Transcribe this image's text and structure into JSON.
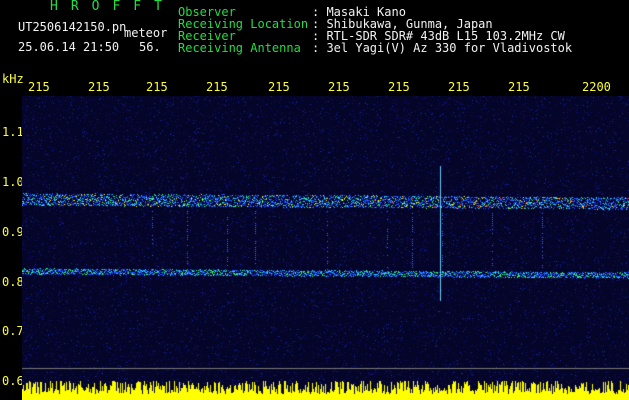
{
  "header": {
    "logo": "HROFFT",
    "filename": "UT2506142150.pn",
    "meteor_label": "meteor",
    "timestamp": "25.06.14 21:50",
    "count": "56."
  },
  "info": [
    {
      "label": "Observer",
      "value": ": Masaki Kano"
    },
    {
      "label": "Receiving Location",
      "value": ": Shibukawa, Gunma, Japan"
    },
    {
      "label": "Receiver",
      "value": ": RTL-SDR SDR# 43dB L15 103.2MHz CW"
    },
    {
      "label": "Receiving Antenna",
      "value": ": 3el Yagi(V) Az 330 for Vladivostok"
    }
  ],
  "axis": {
    "unit": "kHz",
    "x_ticks": [
      "215",
      "215",
      "215",
      "215",
      "215",
      "215",
      "215",
      "215",
      "215",
      "2200"
    ],
    "y_ticks": [
      "1.1",
      "1.0",
      "0.9",
      "0.8",
      "0.7",
      "0.6"
    ]
  },
  "colors": {
    "label_green": "#22dd44",
    "text_white": "#f2f2f2",
    "axis_yellow": "#ffff33",
    "spectrum_bar": "#ffff00"
  }
}
